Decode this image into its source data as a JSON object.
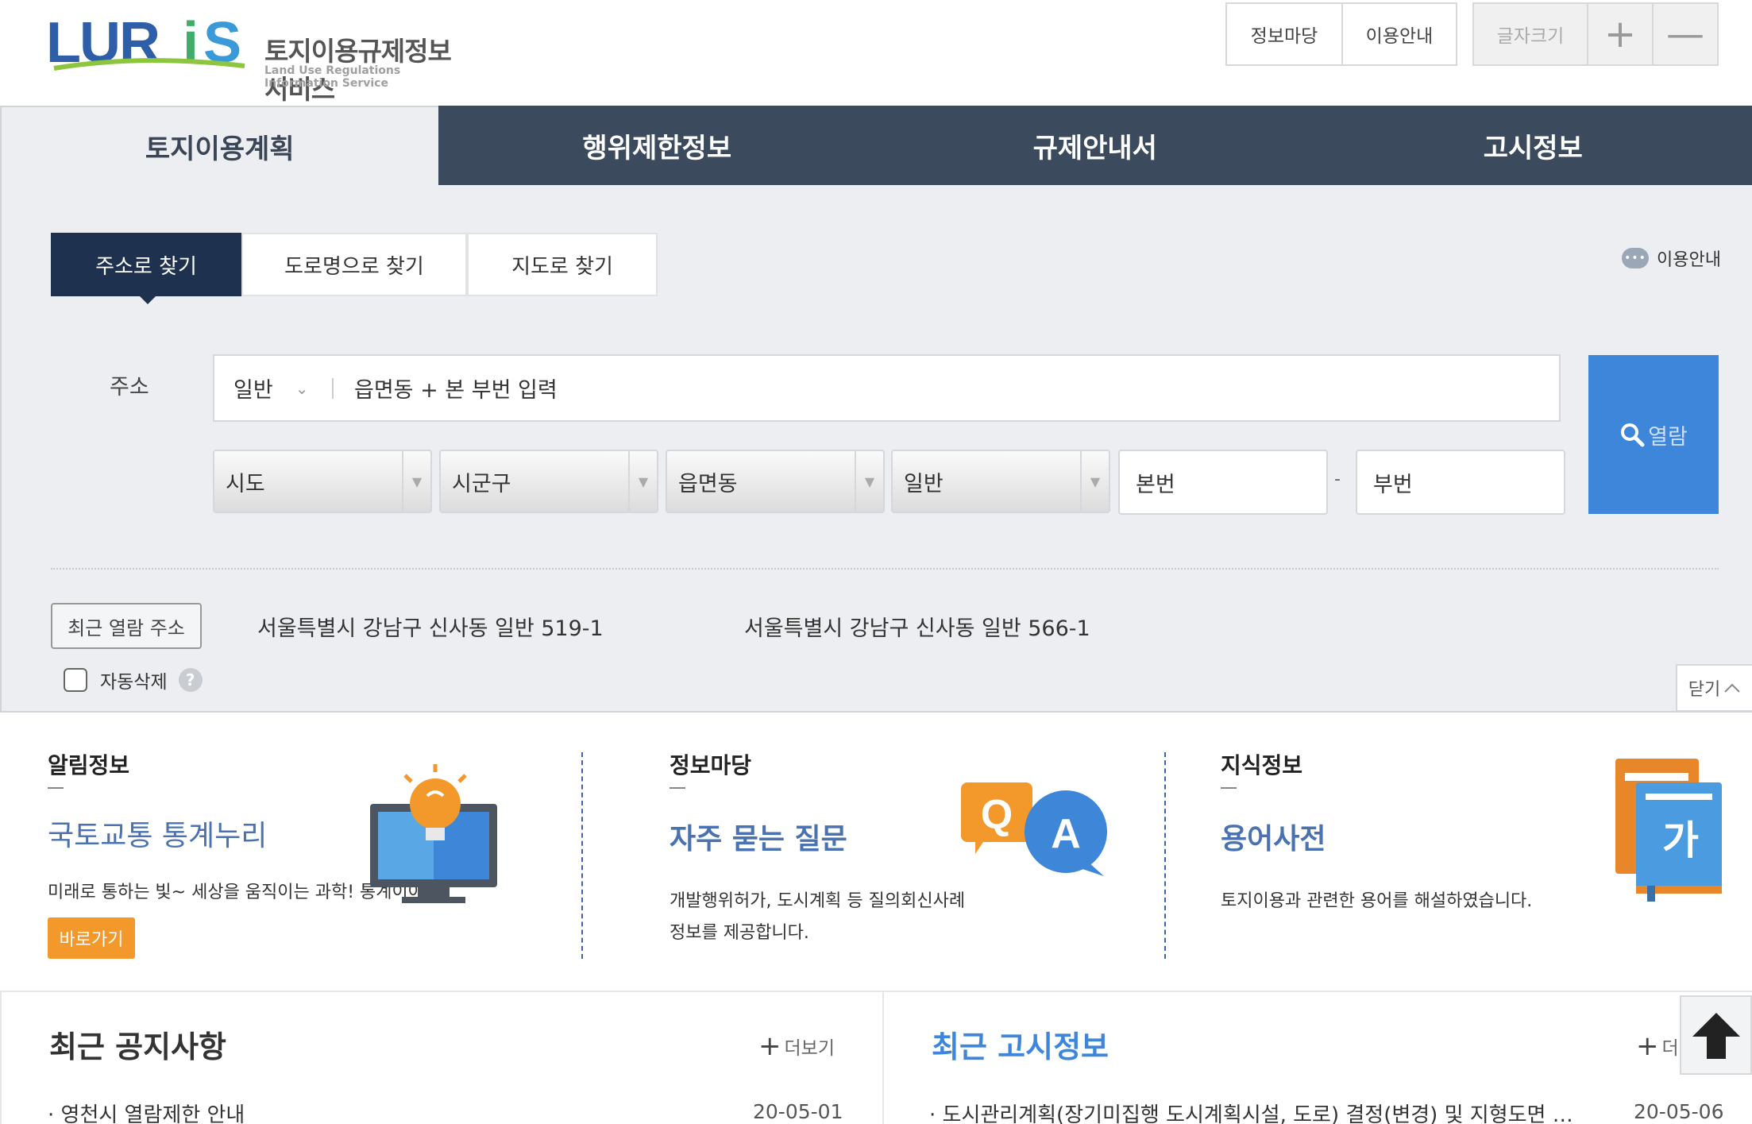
{
  "header": {
    "logo_text": "LURIS",
    "logo_title": "토지이용규제정보서비스",
    "logo_subtitle": "Land Use Regulations Information Service",
    "links": [
      "정보마당",
      "이용안내"
    ],
    "font_size_label": "글자크기",
    "font_plus": "+",
    "font_minus": "—"
  },
  "nav": {
    "tabs": [
      "토지이용계획",
      "행위제한정보",
      "규제안내서",
      "고시정보"
    ],
    "active": "토지이용계획"
  },
  "search": {
    "tabs": [
      "주소로 찾기",
      "도로명으로 찾기",
      "지도로 찾기"
    ],
    "guide_label": "이용안내",
    "guide_icon": "chat-bubble-icon",
    "address_label": "주소",
    "address_type": "일반",
    "address_placeholder": "읍면동 + 본 부번 입력",
    "selects": [
      "시도",
      "시군구",
      "읍면동",
      "일반"
    ],
    "main_number": "본번",
    "sub_number": "부번",
    "separator": "-",
    "view_button": "열람",
    "recent_button": "최근 열람 주소",
    "recent": [
      "서울특별시 강남구 신사동 일반 519-1",
      "서울특별시 강남구 신사동 일반 566-1"
    ],
    "auto_delete": "자동삭제",
    "auto_delete_checked": false,
    "help": "?",
    "close": "닫기"
  },
  "info": {
    "cols": [
      {
        "title": "알림정보",
        "head": "국토교통 통계누리",
        "text": "미래로 통하는 빛~ 세상을 움직이는 과학! 통계이야",
        "button": "바로가기",
        "icon": "monitor-lightbulb-icon"
      },
      {
        "title": "정보마당",
        "head": "자주 묻는 질문",
        "text1": "개발행위허가, 도시계획 등 질의회신사례",
        "text2": "정보를 제공합니다.",
        "icon": "qa-bubbles-icon"
      },
      {
        "title": "지식정보",
        "head": "용어사전",
        "text": "토지이용과 관련한 용어를 해설하였습니다.",
        "icon": "dictionary-book-icon",
        "book_glyph": "가"
      }
    ]
  },
  "notices": {
    "title": "최근 공지사항",
    "more": "더보기",
    "items": [
      {
        "text": "· 영천시 열람제한 안내",
        "date": "20-05-01"
      }
    ]
  },
  "gazette": {
    "title": "최근 고시정보",
    "more": "더",
    "items": [
      {
        "text": "· 도시관리계획(장기미집행 도시계획시설, 도로) 결정(변경) 및 지형도면 …",
        "date": "20-05-06"
      }
    ]
  },
  "colors": {
    "nav_bg": "#3b4a5c",
    "panel_bg": "#eceef2",
    "active_tab": "#1e3250",
    "view_button": "#3d86d9",
    "accent_orange": "#f3982b",
    "head_blue": "#4a72b0"
  }
}
